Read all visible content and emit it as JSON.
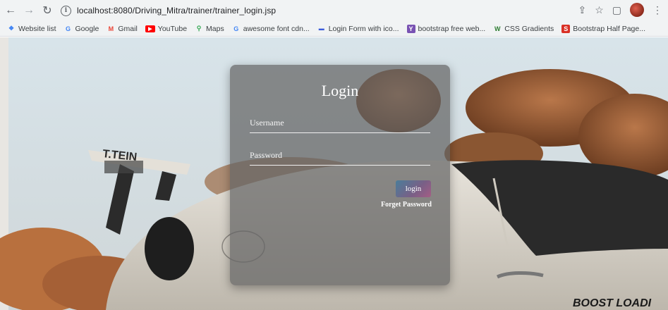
{
  "browser": {
    "url": "localhost:8080/Driving_Mitra/trainer/trainer_login.jsp",
    "nav": {
      "back_icon": "arrow-left-icon",
      "forward_icon": "arrow-right-icon",
      "reload_icon": "reload-icon"
    }
  },
  "bookmarks": [
    {
      "label": "Website list",
      "icon": "apps-icon",
      "color": "#4285f4"
    },
    {
      "label": "Google",
      "icon": "google-icon",
      "color": "#4285f4"
    },
    {
      "label": "Gmail",
      "icon": "gmail-icon",
      "color": "#ea4335"
    },
    {
      "label": "YouTube",
      "icon": "youtube-icon",
      "color": "#ff0000"
    },
    {
      "label": "Maps",
      "icon": "maps-icon",
      "color": "#34a853"
    },
    {
      "label": "awesome font cdn...",
      "icon": "google-icon",
      "color": "#4285f4"
    },
    {
      "label": "Login Form with ico...",
      "icon": "codepen-icon",
      "color": "#3b5bdb"
    },
    {
      "label": "bootstrap free web...",
      "icon": "bootstrap-icon",
      "color": "#7952b3"
    },
    {
      "label": "CSS Gradients",
      "icon": "css-gradient-icon",
      "color": "#2e7d32"
    },
    {
      "label": "Bootstrap Half Page...",
      "icon": "s-icon",
      "color": "#d93025"
    }
  ],
  "login": {
    "title": "Login",
    "username_placeholder": "Username",
    "password_placeholder": "Password",
    "button_label": "login",
    "forget_label": "Forget Password"
  },
  "background": {
    "car_decal_top": "T.TEIN",
    "car_decal_side": "BOOST LOADI"
  }
}
